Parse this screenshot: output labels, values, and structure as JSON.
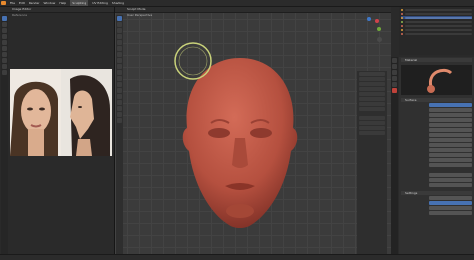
{
  "app": {
    "menu": [
      "File",
      "Edit",
      "Render",
      "Window",
      "Help",
      "Sculpting",
      "UV Editing",
      "Shading"
    ]
  },
  "left_image_editor": {
    "header": "Image Editor",
    "sub": "Reference"
  },
  "viewport": {
    "header": "Sculpt Mode",
    "sub": "User Perspective"
  },
  "properties": {
    "material_name": "Material",
    "section_surface": "Surface",
    "section_settings": "Settings"
  },
  "colors": {
    "accent": "#4772b3",
    "logo": "#e88a2e",
    "head": "#b5503f",
    "brush_ring": "#c9d27a"
  }
}
